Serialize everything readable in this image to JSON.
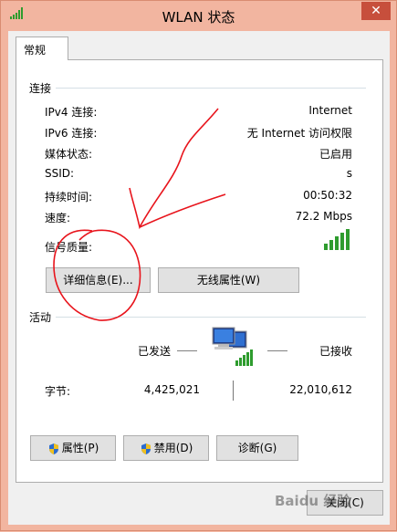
{
  "window": {
    "title": "WLAN 状态",
    "close_glyph": "✕"
  },
  "tabs": [
    {
      "label": "常规"
    }
  ],
  "connection": {
    "header": "连接",
    "rows": [
      {
        "label": "IPv4 连接:",
        "value": "Internet"
      },
      {
        "label": "IPv6 连接:",
        "value": "无 Internet 访问权限"
      },
      {
        "label": "媒体状态:",
        "value": "已启用"
      },
      {
        "label": "SSID:",
        "value": "s"
      },
      {
        "label": "持续时间:",
        "value": "00:50:32"
      },
      {
        "label": "速度:",
        "value": "72.2 Mbps"
      }
    ],
    "signal_label": "信号质量:",
    "signal_bars": 5,
    "signal_color": "#2e9c2e",
    "details_button": "详细信息(E)...",
    "wireless_props_button": "无线属性(W)"
  },
  "activity": {
    "header": "活动",
    "sent_label": "已发送",
    "received_label": "已接收",
    "bytes_label": "字节:",
    "bytes_sent": "4,425,021",
    "bytes_received": "22,010,612"
  },
  "buttons": {
    "properties": "属性(P)",
    "disable": "禁用(D)",
    "diagnose": "诊断(G)",
    "close": "关闭(C)"
  },
  "watermark": "Baidu 经验",
  "colors": {
    "annotation": "#e8141c",
    "title_bg": "#f2b5a0",
    "close_bg": "#c74f3c"
  }
}
